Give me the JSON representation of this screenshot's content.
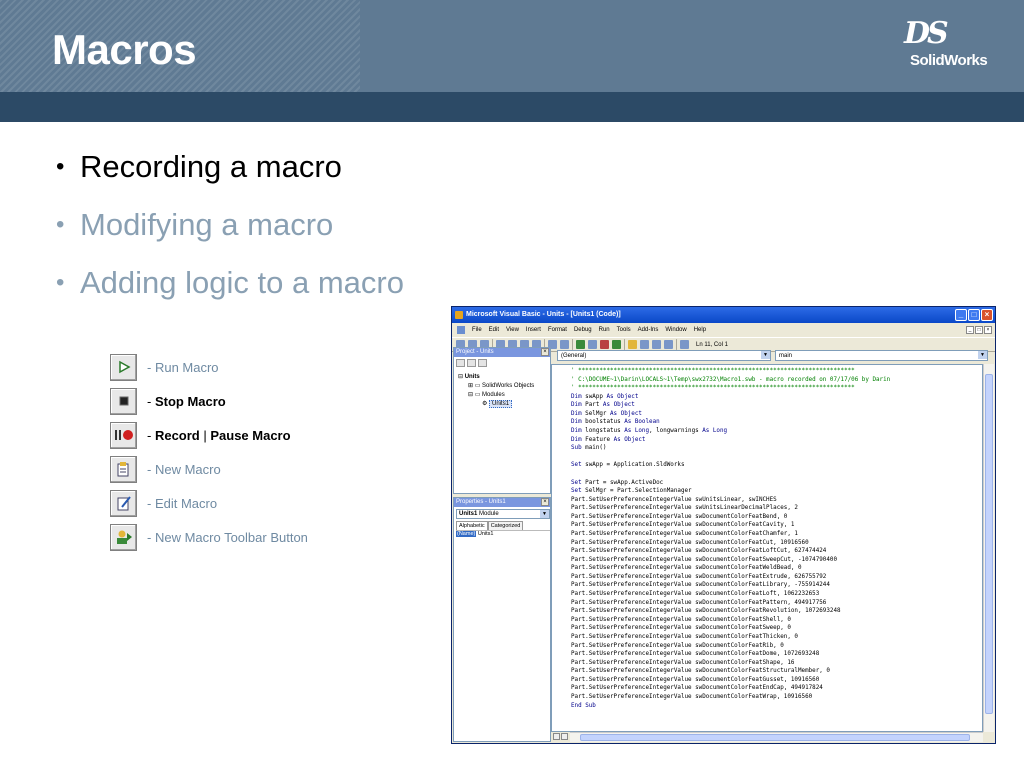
{
  "slide": {
    "title": "Macros",
    "logo": {
      "mark": "DS",
      "brand": "SolidWorks"
    },
    "bullets": [
      {
        "text": "Recording a macro",
        "state": "active"
      },
      {
        "text": "Modifying a macro",
        "state": "dim"
      },
      {
        "text": "Adding logic to a macro",
        "state": "dim"
      }
    ],
    "legend": [
      {
        "icon": "run-macro-icon",
        "prefix": "- ",
        "label": "Run Macro"
      },
      {
        "icon": "stop-macro-icon",
        "prefix": "- ",
        "label": "Stop Macro"
      },
      {
        "icon": "record-pause-macro-icon",
        "prefix": "- ",
        "label_a": "Record",
        "sep": " | ",
        "label_b": "Pause Macro"
      },
      {
        "icon": "new-macro-icon",
        "prefix": "- ",
        "label": "New Macro"
      },
      {
        "icon": "edit-macro-icon",
        "prefix": "- ",
        "label": "Edit Macro"
      },
      {
        "icon": "new-macro-toolbar-button-icon",
        "prefix": "- ",
        "label": "New Macro Toolbar Button"
      }
    ],
    "colors": {
      "header": "#5f7a93",
      "band": "#2c4a66",
      "dim_text": "#8aa0b3",
      "legend_text": "#6f8aa2"
    }
  },
  "vb": {
    "title": "Microsoft Visual Basic - Units - [Units1 (Code)]",
    "menu": [
      "File",
      "Edit",
      "View",
      "Insert",
      "Format",
      "Debug",
      "Run",
      "Tools",
      "Add-Ins",
      "Window",
      "Help"
    ],
    "status": "Ln 11, Col 1",
    "project_title": "Project - Units",
    "tree": {
      "root": "Units",
      "objects": "SolidWorks Objects",
      "modules": "Modules",
      "module": "Units1"
    },
    "props_title": "Properties - Units1",
    "props_object": "Units1",
    "props_object_type": "Module",
    "tab_alpha": "Alphabetic",
    "tab_cat": "Categorized",
    "prop_name_key": "(Name)",
    "prop_name_val": "Units1",
    "combo_object": "(General)",
    "combo_proc": "main",
    "code_lines": [
      "' ******************************************************************************",
      "' C:\\DOCUME~1\\Darin\\LOCALS~1\\Temp\\swx2732\\Macro1.swb - macro recorded on 07/17/06 by Darin",
      "' ******************************************************************************",
      "Dim swApp As Object",
      "Dim Part As Object",
      "Dim SelMgr As Object",
      "Dim boolstatus As Boolean",
      "Dim longstatus As Long, longwarnings As Long",
      "Dim Feature As Object",
      "Sub main()",
      "",
      "Set swApp = Application.SldWorks",
      "",
      "Set Part = swApp.ActiveDoc",
      "Set SelMgr = Part.SelectionManager",
      "Part.SetUserPreferenceIntegerValue swUnitsLinear, swINCHES",
      "Part.SetUserPreferenceIntegerValue swUnitsLinearDecimalPlaces, 2",
      "Part.SetUserPreferenceIntegerValue swDocumentColorFeatBend, 0",
      "Part.SetUserPreferenceIntegerValue swDocumentColorFeatCavity, 1",
      "Part.SetUserPreferenceIntegerValue swDocumentColorFeatChamfer, 1",
      "Part.SetUserPreferenceIntegerValue swDocumentColorFeatCut, 10916560",
      "Part.SetUserPreferenceIntegerValue swDocumentColorFeatLoftCut, 627474424",
      "Part.SetUserPreferenceIntegerValue swDocumentColorFeatSweepCut, -1074790400",
      "Part.SetUserPreferenceIntegerValue swDocumentColorFeatWeldBead, 0",
      "Part.SetUserPreferenceIntegerValue swDocumentColorFeatExtrude, 626755792",
      "Part.SetUserPreferenceIntegerValue swDocumentColorFeatLibrary, -755914244",
      "Part.SetUserPreferenceIntegerValue swDocumentColorFeatLoft, 1062232653",
      "Part.SetUserPreferenceIntegerValue swDocumentColorFeatPattern, 494917756",
      "Part.SetUserPreferenceIntegerValue swDocumentColorFeatRevolution, 1072693248",
      "Part.SetUserPreferenceIntegerValue swDocumentColorFeatShell, 0",
      "Part.SetUserPreferenceIntegerValue swDocumentColorFeatSweep, 0",
      "Part.SetUserPreferenceIntegerValue swDocumentColorFeatThicken, 0",
      "Part.SetUserPreferenceIntegerValue swDocumentColorFeatRib, 0",
      "Part.SetUserPreferenceIntegerValue swDocumentColorFeatDome, 1072693248",
      "Part.SetUserPreferenceIntegerValue swDocumentColorFeatShape, 16",
      "Part.SetUserPreferenceIntegerValue swDocumentColorFeatStructuralMember, 0",
      "Part.SetUserPreferenceIntegerValue swDocumentColorFeatGusset, 10916560",
      "Part.SetUserPreferenceIntegerValue swDocumentColorFeatEndCap, 494917824",
      "Part.SetUserPreferenceIntegerValue swDocumentColorFeatWrap, 10916560",
      "End Sub"
    ]
  }
}
